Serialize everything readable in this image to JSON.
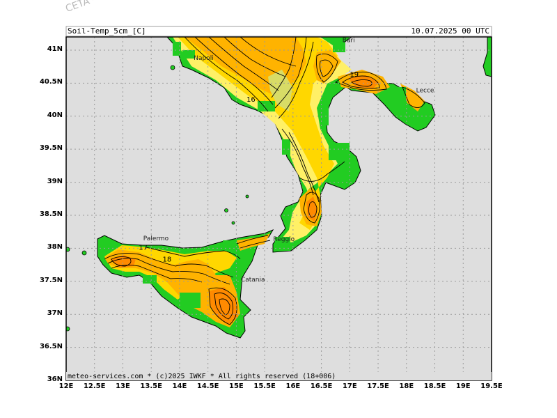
{
  "watermark": "CETA - ...",
  "header": {
    "variable": "Soil-Temp_5cm_[C]",
    "datetime": "10.07.2025 00 UTC"
  },
  "footer": "meteo-services.com * (c)2025 IWKF * All rights reserved (18+006)",
  "axes": {
    "lat_labels": [
      "41N",
      "40.5N",
      "40N",
      "39.5N",
      "39N",
      "38.5N",
      "38N",
      "37.5N",
      "37N",
      "36.5N",
      "36N"
    ],
    "lon_labels": [
      "12E",
      "12.5E",
      "13E",
      "13.5E",
      "14E",
      "14.5E",
      "15E",
      "15.5E",
      "16E",
      "16.5E",
      "17E",
      "17.5E",
      "18E",
      "18.5E",
      "19E",
      "19.5E"
    ],
    "lat_range": [
      36,
      41.2
    ],
    "lon_range": [
      12,
      19.5
    ]
  },
  "places": [
    {
      "name": "Napoli",
      "lon": 14.25,
      "lat": 40.85
    },
    {
      "name": "Bari",
      "lon": 16.87,
      "lat": 41.12
    },
    {
      "name": "Lecce",
      "lon": 18.17,
      "lat": 40.36
    },
    {
      "name": "Palermo",
      "lon": 13.36,
      "lat": 38.12
    },
    {
      "name": "Catania",
      "lon": 15.08,
      "lat": 37.5
    },
    {
      "name": "Reggio",
      "lon": 15.65,
      "lat": 38.11
    }
  ],
  "contour_labels": [
    {
      "text": "19",
      "lon": 17.0,
      "lat": 40.6
    },
    {
      "text": "18",
      "lon": 13.7,
      "lat": 37.8
    },
    {
      "text": "17",
      "lon": 13.28,
      "lat": 37.98
    },
    {
      "text": "16",
      "lon": 15.18,
      "lat": 40.22
    }
  ],
  "colors": {
    "sea": "#dedede",
    "land_cool": "#22cc22",
    "temp_low": "#fff066",
    "temp_mid": "#ffd700",
    "temp_high": "#ffb300",
    "temp_peak": "#ff8a00",
    "grid": "#9a9a9a"
  }
}
